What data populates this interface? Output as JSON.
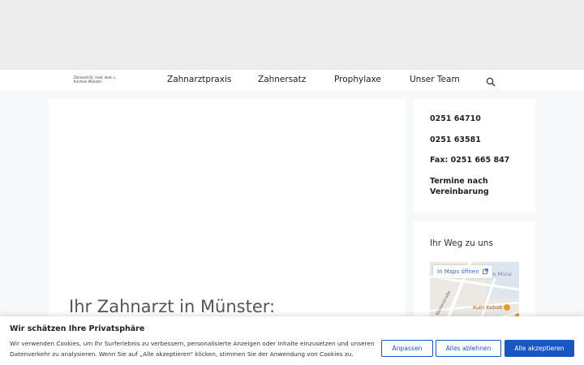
{
  "header": {
    "logo_text": "Zahnarzt Dr. med. dent. L. Kirchner Münster",
    "nav": [
      {
        "label": "Zahnarztpraxis"
      },
      {
        "label": "Zahnersatz"
      },
      {
        "label": "Prophylaxe"
      },
      {
        "label": "Unser Team"
      }
    ],
    "search_icon": "search-icon"
  },
  "main": {
    "title": "Ihr Zahnarzt in Münster:"
  },
  "contact": {
    "phone1": "0251 64710",
    "phone2": "0251 63581",
    "fax": "Fax: 0251 665 847",
    "appointments": "Termine nach Vereinbarung"
  },
  "map": {
    "heading": "Ihr Weg zu uns",
    "open_maps_label": "In Maps öffnen",
    "street_label": "Klosterstraße",
    "museum_label": "eum Müns",
    "poi_label": "Kulti Kebab"
  },
  "cookie": {
    "title": "Wir schätzen Ihre Privatsphäre",
    "text": "Wir verwenden Cookies, um Ihr Surferlebnis zu verbessern, personalisierte Anzeigen oder Inhalte einzusetzen und unseren Datenverkehr zu analysieren. Wenn Sie auf „Alle akzeptieren“ klicken, stimmen Sie der Anwendung von Cookies zu.",
    "customize_label": "Anpassen",
    "reject_label": "Alles ablehnen",
    "accept_label": "Alle akzeptieren"
  },
  "colors": {
    "accent": "#1a56c2",
    "top_band": "#ededed",
    "page_bg": "#f7f8f9"
  }
}
